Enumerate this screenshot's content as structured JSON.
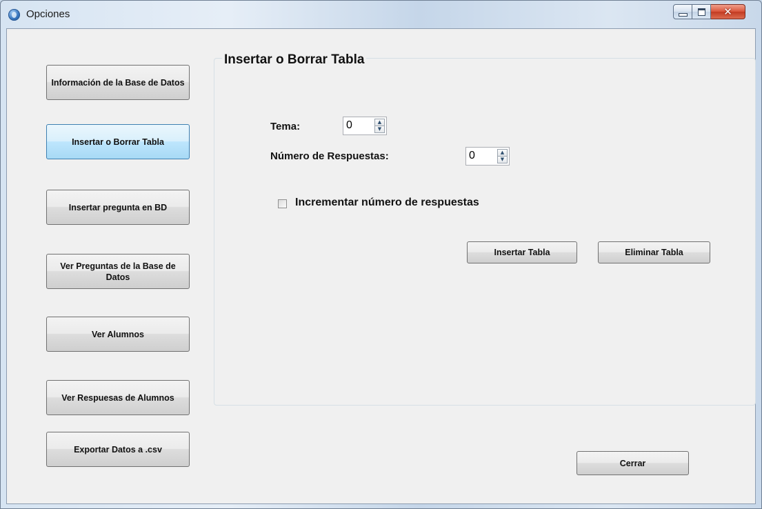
{
  "window": {
    "title": "Opciones",
    "icon": "app-globe-icon"
  },
  "caption_buttons": {
    "minimize": "minimize-icon",
    "maximize": "maximize-icon",
    "close": "close-icon"
  },
  "sidebar": {
    "items": [
      {
        "label": "Información de la Base de Datos",
        "active": false
      },
      {
        "label": "Insertar o Borrar Tabla",
        "active": true
      },
      {
        "label": "Insertar pregunta en BD",
        "active": false
      },
      {
        "label": "Ver Preguntas de la Base de Datos",
        "active": false
      },
      {
        "label": "Ver Alumnos",
        "active": false
      },
      {
        "label": "Ver Respuesas de Alumnos",
        "active": false
      },
      {
        "label": "Exportar Datos a .csv",
        "active": false
      }
    ]
  },
  "panel": {
    "title": "Insertar o Borrar Tabla",
    "tema": {
      "label": "Tema:",
      "value": "0"
    },
    "respuestas": {
      "label": "Número de Respuestas:",
      "value": "0"
    },
    "checkbox": {
      "label": "Incrementar número de respuestas",
      "checked": false
    },
    "insert_label": "Insertar Tabla",
    "delete_label": "Eliminar Tabla"
  },
  "footer": {
    "close_label": "Cerrar"
  },
  "colors": {
    "active_button": "#bee6fd",
    "close_caption": "#c94a32"
  }
}
